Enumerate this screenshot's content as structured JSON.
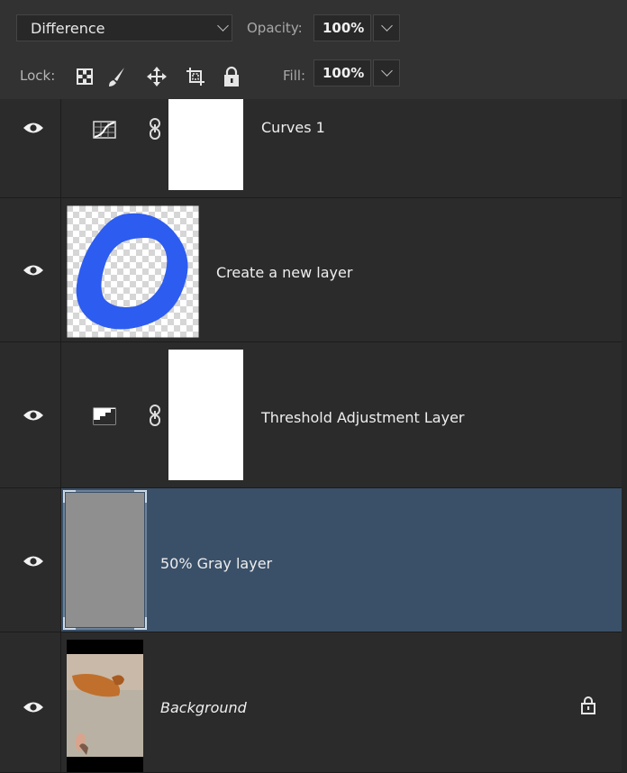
{
  "panel": {
    "blend_mode": "Difference",
    "opacity_label": "Opacity:",
    "opacity_value": "100%",
    "lock_label": "Lock:",
    "fill_label": "Fill:",
    "fill_value": "100%",
    "lock_icons": [
      "lock-transparent-pixels-icon",
      "lock-image-pixels-icon",
      "lock-position-icon",
      "lock-artboard-icon",
      "lock-all-icon"
    ]
  },
  "layers": [
    {
      "name": "Curves 1",
      "type": "adjustment",
      "adjustment_icon": "curves-icon",
      "visible": true,
      "selected": false,
      "has_mask": true,
      "mask_link": true
    },
    {
      "name": "Create a new layer",
      "type": "pixel",
      "thumbnail": "blue-brush-stroke-on-transparent",
      "visible": true,
      "selected": false
    },
    {
      "name": "Threshold Adjustment Layer",
      "type": "adjustment",
      "adjustment_icon": "threshold-icon",
      "visible": true,
      "selected": false,
      "has_mask": true,
      "mask_link": true
    },
    {
      "name": "50% Gray layer",
      "type": "pixel",
      "thumbnail": "gray-fill",
      "visible": true,
      "selected": true
    },
    {
      "name": "Background",
      "type": "background",
      "thumbnail": "cat-photo",
      "visible": true,
      "selected": false,
      "locked": true,
      "italic": true
    }
  ],
  "colors": {
    "panel_bg": "#2b2b2b",
    "selected_bg": "#3a5068",
    "brush_blue": "#2d5cf0",
    "gray_fill": "#8f8f8f"
  }
}
